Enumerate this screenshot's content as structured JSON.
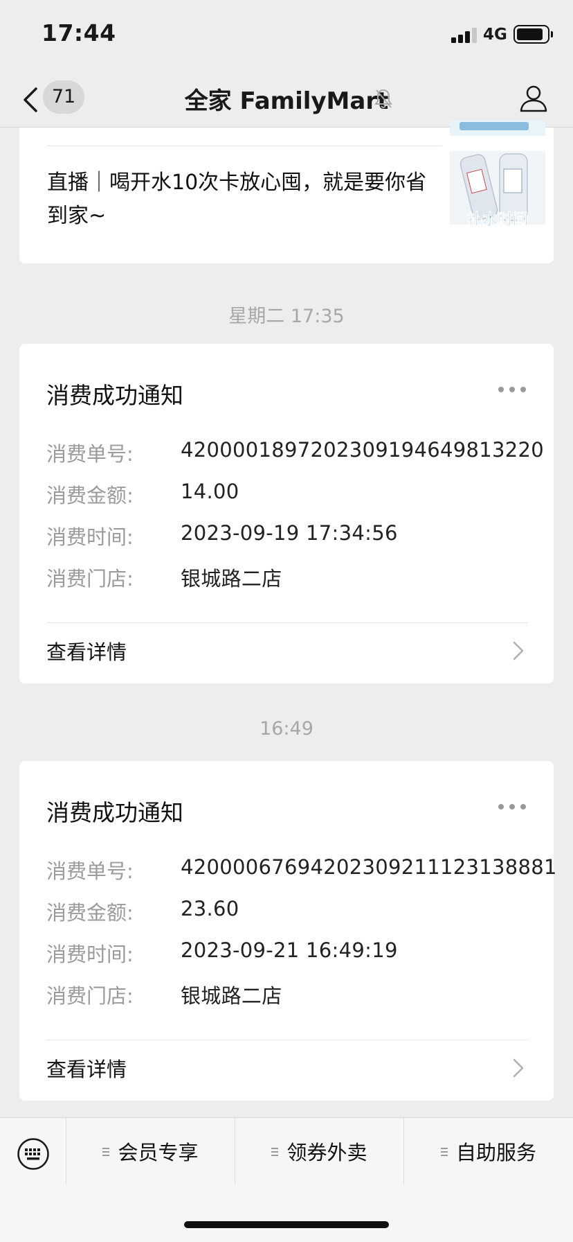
{
  "status_bar": {
    "time": "17:44",
    "network": "4G"
  },
  "nav": {
    "unread_count": "71",
    "title": "全家 FamilyMart"
  },
  "article": {
    "title": "直播｜喝开水10次卡放心囤，就是要你省到家~",
    "thumbnail_caption": "补水时间"
  },
  "messages": [
    {
      "timestamp": "星期二 17:35",
      "title": "消费成功通知",
      "fields": [
        {
          "label": "消费单号:",
          "value": "4200001897202309194649813220"
        },
        {
          "label": "消费金额:",
          "value": "14.00"
        },
        {
          "label": "消费时间:",
          "value": "2023-09-19 17:34:56"
        },
        {
          "label": "消费门店:",
          "value": "银城路二店"
        }
      ],
      "detail_link": "查看详情"
    },
    {
      "timestamp": "16:49",
      "title": "消费成功通知",
      "fields": [
        {
          "label": "消费单号:",
          "value": "4200006769420230921112313888​1"
        },
        {
          "label": "消费金额:",
          "value": "23.60"
        },
        {
          "label": "消费时间:",
          "value": "2023-09-21 16:49:19"
        },
        {
          "label": "消费门店:",
          "value": "银城路二店"
        }
      ],
      "detail_link": "查看详情"
    }
  ],
  "bottom_menu": {
    "items": [
      "会员专享",
      "领券外卖",
      "自助服务"
    ]
  },
  "icons": {
    "back": "chevron-left-icon",
    "mute": "bell-off-icon",
    "profile": "person-icon",
    "more": "more-dots-icon",
    "detail": "chevron-right-icon",
    "keyboard": "keyboard-icon"
  }
}
